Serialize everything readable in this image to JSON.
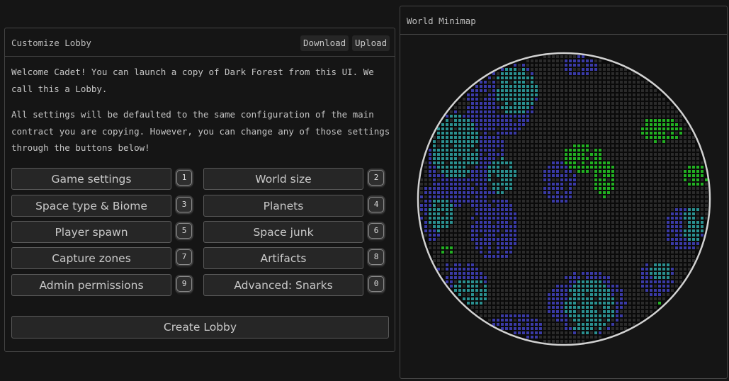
{
  "lobby": {
    "title": "Customize Lobby",
    "download_label": "Download",
    "upload_label": "Upload",
    "intro1": "Welcome Cadet! You can launch a copy of Dark Forest from this UI. We call this a Lobby.",
    "intro2": "All settings will be defaulted to the same configuration of the main contract you are copying. However, you can change any of those settings through the buttons below!",
    "settings": [
      {
        "label": "Game settings",
        "key": "1"
      },
      {
        "label": "World size",
        "key": "2"
      },
      {
        "label": "Space type & Biome",
        "key": "3"
      },
      {
        "label": "Planets",
        "key": "4"
      },
      {
        "label": "Player spawn",
        "key": "5"
      },
      {
        "label": "Space junk",
        "key": "6"
      },
      {
        "label": "Capture zones",
        "key": "7"
      },
      {
        "label": "Artifacts",
        "key": "8"
      },
      {
        "label": "Admin permissions",
        "key": "9"
      },
      {
        "label": "Advanced: Snarks",
        "key": "0"
      }
    ],
    "create_label": "Create Lobby"
  },
  "minimap": {
    "title": "World Minimap",
    "colors": {
      "background": "#0a0a0a",
      "empty_dot": "#2b2b2b",
      "nebula": "#3a3aa6",
      "space": "#2a9090",
      "deep_space": "#22b022",
      "ring": "#d2d2d2"
    }
  }
}
